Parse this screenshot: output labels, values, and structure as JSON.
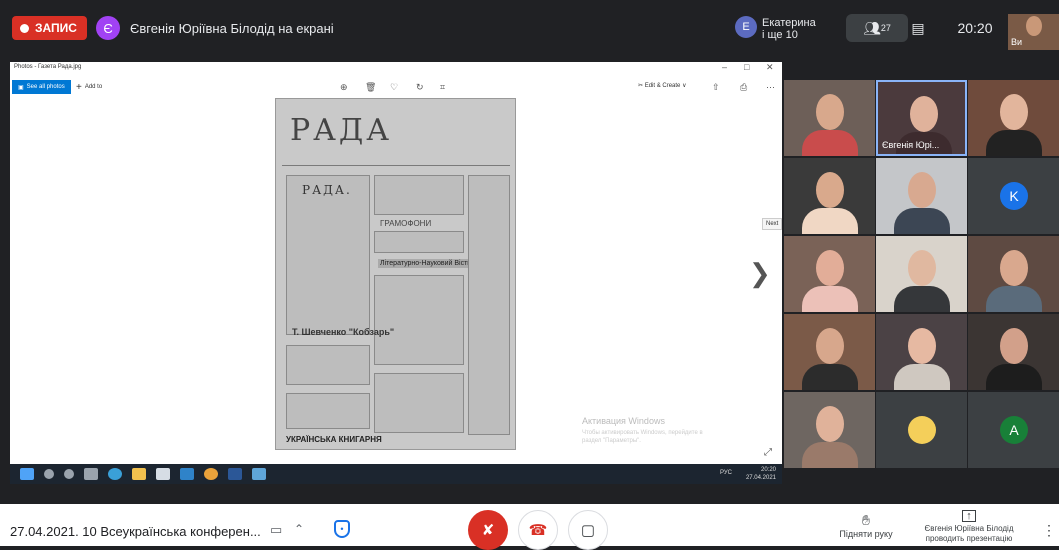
{
  "topbar": {
    "rec_label": "ЗАПИС",
    "presenter_initial": "Є",
    "presenter_text": "Євгенія Юріївна Білодід на екрані",
    "people_initial": "E",
    "people_name": "Екатерина",
    "people_more": "і ще 10",
    "participants_count": "27",
    "clock": "20:20",
    "self_label": "Ви"
  },
  "photos": {
    "window_title": "Photos - Газета Рада.jpg",
    "see_all": "See all photos",
    "add_to": "Add to",
    "edit_create": "Edit & Create",
    "next_tooltip": "Next",
    "newspaper_title": "РАДА",
    "newspaper_sub": "РАДА.",
    "kobzar": "Т. Шевченко \"Кобзарь\"",
    "gramofon": "ГРАМОФОНИ",
    "lit_sci": "Літературно-Науковий Вістник",
    "ukr_knyharnia": "УКРАЇНСЬКА КНИГАРНЯ"
  },
  "windows": {
    "activation_title": "Активация Windows",
    "activation_body": "Чтобы активировать Windows, перейдите в раздел \"Параметры\".",
    "tray_lang": "РУС",
    "tray_time": "20:20",
    "tray_date": "27.04.2021"
  },
  "grid": {
    "tile_name_2": "Євгенія Юрі...",
    "tile_letter_k": "K",
    "tile_letter_a": "A"
  },
  "bottom": {
    "meeting_title": "27.04.2021. 10 Всеукраїнська конферен...",
    "raise_hand": "Підняти руку",
    "presenting": "Євгенія Юріївна Білодід проводить презентацію"
  },
  "colors": {
    "accent_red": "#d93025",
    "accent_blue": "#1a73e8",
    "meet_dark": "#202124"
  }
}
